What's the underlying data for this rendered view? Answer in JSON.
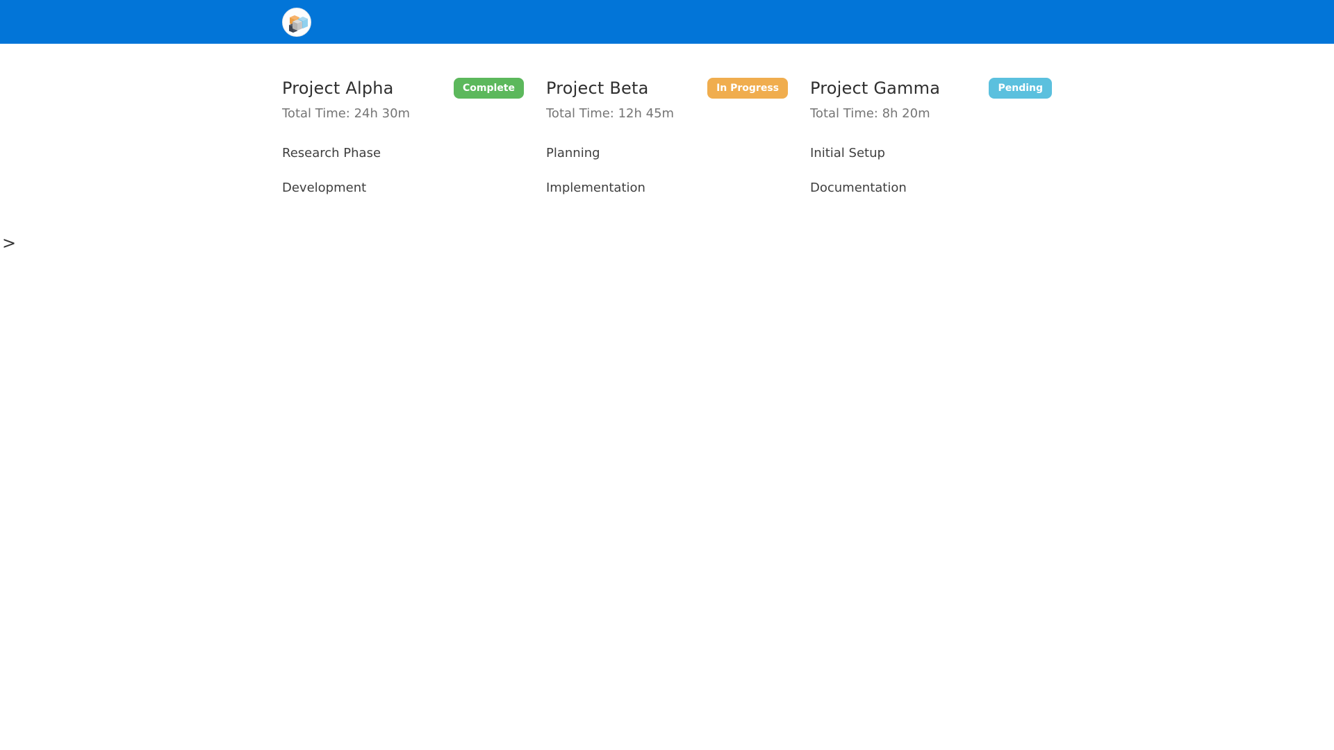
{
  "header": {
    "background_color": "#0275d8",
    "logo_icon": "cubes-logo-icon"
  },
  "stray_text": ">",
  "projects": [
    {
      "name": "Project Alpha",
      "status": "Complete",
      "status_color": "#5cb85c",
      "total_time": "Total Time: 24h 30m",
      "tasks": [
        "Research Phase",
        "Development"
      ]
    },
    {
      "name": "Project Beta",
      "status": "In Progress",
      "status_color": "#f0ad4e",
      "total_time": "Total Time: 12h 45m",
      "tasks": [
        "Planning",
        "Implementation"
      ]
    },
    {
      "name": "Project Gamma",
      "status": "Pending",
      "status_color": "#5bc0de",
      "total_time": "Total Time: 8h 20m",
      "tasks": [
        "Initial Setup",
        "Documentation"
      ]
    }
  ]
}
